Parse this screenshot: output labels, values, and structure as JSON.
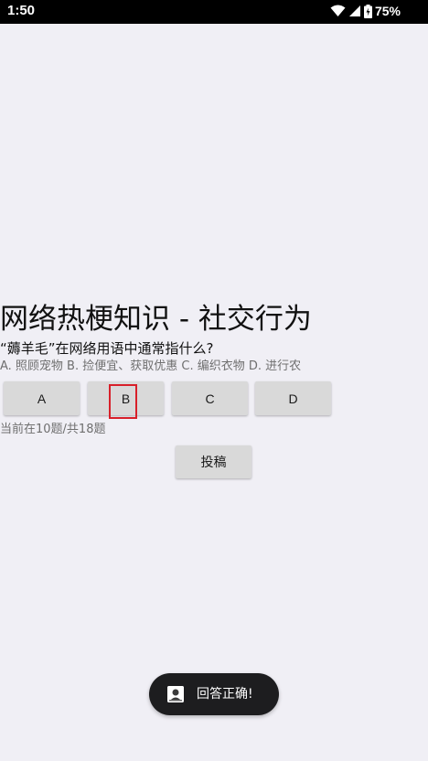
{
  "status_bar": {
    "time": "1:50",
    "battery_percent": "75%",
    "icons": [
      "wifi-icon",
      "signal-icon",
      "battery-charging-icon"
    ]
  },
  "quiz": {
    "title": "网络热梗知识 - 社交行为",
    "question": "“薅羊毛”在网络用语中通常指什么?",
    "options_text": "A. 照顾宠物  B. 捡便宜、获取优惠  C. 编织衣物  D. 进行农",
    "answer_buttons": [
      "A",
      "B",
      "C",
      "D"
    ],
    "progress": "当前在10题/共18题",
    "submit_label": "投稿"
  },
  "toast": {
    "message": "回答正确!",
    "icon": "app-icon"
  },
  "colors": {
    "background": "#f0eff5",
    "button": "#d9d9d9",
    "highlight": "#d8202a",
    "toast_bg": "#1d1d1f"
  }
}
